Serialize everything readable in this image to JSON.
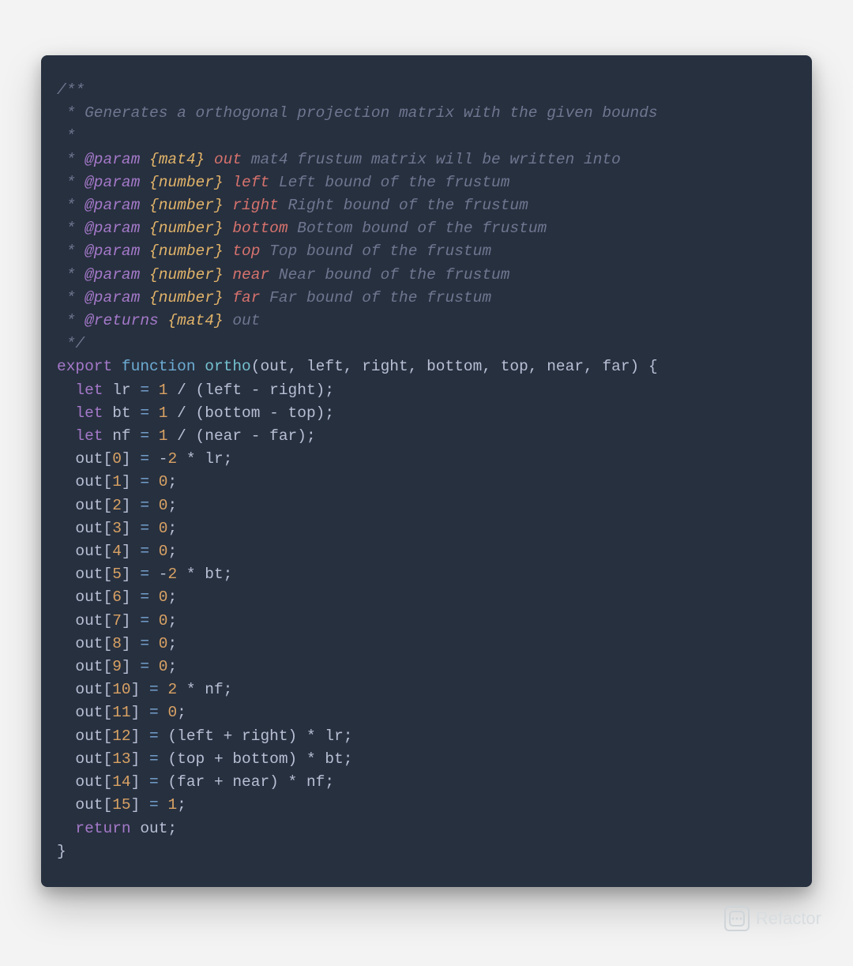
{
  "colors": {
    "page_bg": "#f3f3f3",
    "code_bg": "#27303f",
    "comment": "#6f7690",
    "type": "#e2b469",
    "tag": "#a479c9",
    "param_name": "#d6726d",
    "keyword": "#a479c9",
    "function_kw": "#6dacd3",
    "function_name": "#74c1cf",
    "number": "#d9a264",
    "operator": "#7aa7d6",
    "identifier": "#b8bfd5"
  },
  "watermark": {
    "label": "Refactor",
    "icon": "wechat-bubble-icon"
  },
  "code": {
    "doc": {
      "open": "/**",
      "star": " * ",
      "close": " */",
      "summary": "Generates a orthogonal projection matrix with the given bounds",
      "returns_tag": "@returns",
      "returns_type": "{mat4}",
      "returns_name": "out",
      "params": [
        {
          "tag": "@param",
          "type": "{mat4}",
          "name": "out",
          "desc": "mat4 frustum matrix will be written into"
        },
        {
          "tag": "@param",
          "type": "{number}",
          "name": "left",
          "desc": "Left bound of the frustum"
        },
        {
          "tag": "@param",
          "type": "{number}",
          "name": "right",
          "desc": "Right bound of the frustum"
        },
        {
          "tag": "@param",
          "type": "{number}",
          "name": "bottom",
          "desc": "Bottom bound of the frustum"
        },
        {
          "tag": "@param",
          "type": "{number}",
          "name": "top",
          "desc": "Top bound of the frustum"
        },
        {
          "tag": "@param",
          "type": "{number}",
          "name": "near",
          "desc": "Near bound of the frustum"
        },
        {
          "tag": "@param",
          "type": "{number}",
          "name": "far",
          "desc": "Far bound of the frustum"
        }
      ]
    },
    "sig": {
      "export": "export",
      "function": "function",
      "name": "ortho",
      "params_open": "(",
      "params": "out, left, right, bottom, top, near, far",
      "params_close": ") {"
    },
    "lets": [
      {
        "kw": "let",
        "lhs": "lr",
        "eq": "=",
        "n": "1",
        "rest": " / (left - right);"
      },
      {
        "kw": "let",
        "lhs": "bt",
        "eq": "=",
        "n": "1",
        "rest": " / (bottom - top);"
      },
      {
        "kw": "let",
        "lhs": "nf",
        "eq": "=",
        "n": "1",
        "rest": " / (near - far);"
      }
    ],
    "outs": [
      {
        "pre": "out[",
        "idx": "0",
        "post": "] ",
        "eq": "=",
        "rhs1": " -",
        "n1": "2",
        "rhs2": " * lr;"
      },
      {
        "pre": "out[",
        "idx": "1",
        "post": "] ",
        "eq": "=",
        "rhs1": " ",
        "n1": "0",
        "rhs2": ";"
      },
      {
        "pre": "out[",
        "idx": "2",
        "post": "] ",
        "eq": "=",
        "rhs1": " ",
        "n1": "0",
        "rhs2": ";"
      },
      {
        "pre": "out[",
        "idx": "3",
        "post": "] ",
        "eq": "=",
        "rhs1": " ",
        "n1": "0",
        "rhs2": ";"
      },
      {
        "pre": "out[",
        "idx": "4",
        "post": "] ",
        "eq": "=",
        "rhs1": " ",
        "n1": "0",
        "rhs2": ";"
      },
      {
        "pre": "out[",
        "idx": "5",
        "post": "] ",
        "eq": "=",
        "rhs1": " -",
        "n1": "2",
        "rhs2": " * bt;"
      },
      {
        "pre": "out[",
        "idx": "6",
        "post": "] ",
        "eq": "=",
        "rhs1": " ",
        "n1": "0",
        "rhs2": ";"
      },
      {
        "pre": "out[",
        "idx": "7",
        "post": "] ",
        "eq": "=",
        "rhs1": " ",
        "n1": "0",
        "rhs2": ";"
      },
      {
        "pre": "out[",
        "idx": "8",
        "post": "] ",
        "eq": "=",
        "rhs1": " ",
        "n1": "0",
        "rhs2": ";"
      },
      {
        "pre": "out[",
        "idx": "9",
        "post": "] ",
        "eq": "=",
        "rhs1": " ",
        "n1": "0",
        "rhs2": ";"
      },
      {
        "pre": "out[",
        "idx": "10",
        "post": "] ",
        "eq": "=",
        "rhs1": " ",
        "n1": "2",
        "rhs2": " * nf;"
      },
      {
        "pre": "out[",
        "idx": "11",
        "post": "] ",
        "eq": "=",
        "rhs1": " ",
        "n1": "0",
        "rhs2": ";"
      },
      {
        "pre": "out[",
        "idx": "12",
        "post": "] ",
        "eq": "=",
        "rhs1": " (left + right) * lr;",
        "n1": "",
        "rhs2": ""
      },
      {
        "pre": "out[",
        "idx": "13",
        "post": "] ",
        "eq": "=",
        "rhs1": " (top + bottom) * bt;",
        "n1": "",
        "rhs2": ""
      },
      {
        "pre": "out[",
        "idx": "14",
        "post": "] ",
        "eq": "=",
        "rhs1": " (far + near) * nf;",
        "n1": "",
        "rhs2": ""
      },
      {
        "pre": "out[",
        "idx": "15",
        "post": "] ",
        "eq": "=",
        "rhs1": " ",
        "n1": "1",
        "rhs2": ";"
      }
    ],
    "ret": {
      "kw": "return",
      "val": " out;"
    },
    "close": "}"
  }
}
